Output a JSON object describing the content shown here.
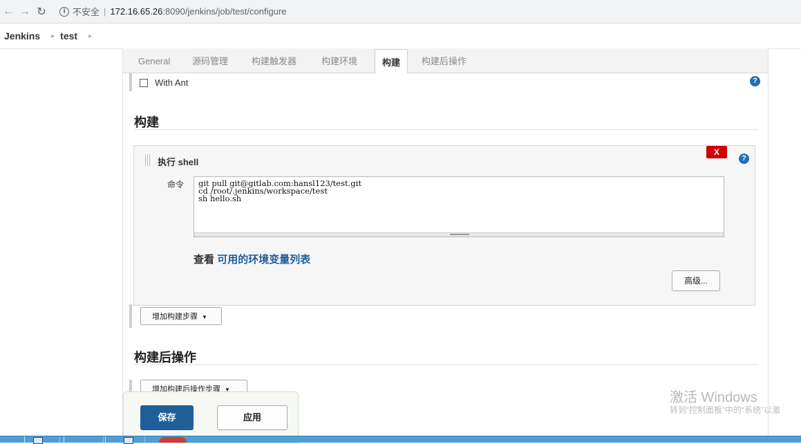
{
  "browser": {
    "security_label": "不安全",
    "url_host": "172.16.65.26",
    "url_path": ":8090/jenkins/job/test/configure",
    "info_icon": "info-icon"
  },
  "breadcrumb": {
    "items": [
      "Jenkins",
      "test"
    ]
  },
  "tabs": [
    "General",
    "源码管理",
    "构建触发器",
    "构建环境",
    "构建",
    "构建后操作"
  ],
  "active_tab": "构建",
  "ant": {
    "checkbox_label": "With Ant",
    "checked": false
  },
  "build": {
    "section_title": "构建",
    "step_title": "执行 shell",
    "delete_label": "X",
    "command_label": "命令",
    "command_text": "git pull git@gitlab.com:hansl123/test.git\ncd /root/.jenkins/workspace/test\nsh hello.sh",
    "env_prefix": "查看",
    "env_link": "可用的环境变量列表",
    "advanced_button": "高级...",
    "add_step_button": "增加构建步骤"
  },
  "post_build": {
    "section_title": "构建后操作",
    "add_step_button": "增加构建后操作步骤"
  },
  "actions": {
    "save": "保存",
    "apply": "应用"
  },
  "watermark": {
    "title": "激活 Windows",
    "subtitle": "转到“控制面板”中的“系统”以激"
  },
  "colors": {
    "primary": "#1f5f99",
    "help": "#1f6fb5",
    "danger": "#cc0000",
    "taskbar": "#4f9fd6"
  }
}
